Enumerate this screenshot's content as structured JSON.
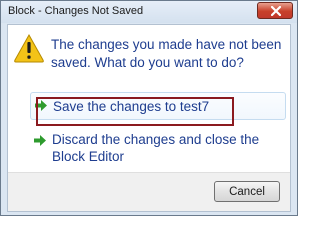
{
  "window": {
    "title": "Block - Changes Not Saved"
  },
  "dialog": {
    "instruction": "The changes you made have not been saved. What do you want to do?",
    "icon": "warning-icon"
  },
  "commands": [
    {
      "label": "Save the changes to test7",
      "icon": "green-arrow-icon",
      "highlighted": true
    },
    {
      "label": "Discard the changes and close the Block Editor",
      "icon": "green-arrow-icon"
    }
  ],
  "footer": {
    "cancel_label": "Cancel"
  },
  "colors": {
    "instruction_text": "#1e3d8f",
    "highlight_box": "#8b1a1f",
    "close_button": "#c8402a"
  }
}
